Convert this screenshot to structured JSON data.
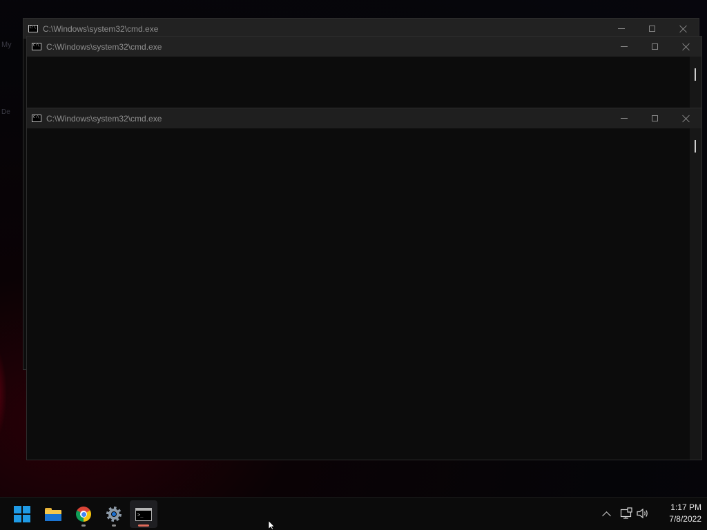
{
  "desktop": {
    "ghost_icon_labels": [
      "My",
      "De"
    ]
  },
  "windows": [
    {
      "title": "C:\\Windows\\system32\\cmd.exe",
      "state": "background",
      "controls": {
        "minimize": "minimize-icon",
        "maximize": "maximize-icon",
        "close": "close-icon"
      }
    },
    {
      "title": "C:\\Windows\\system32\\cmd.exe",
      "state": "background",
      "controls": {
        "minimize": "minimize-icon",
        "maximize": "maximize-icon",
        "close": "close-icon"
      }
    },
    {
      "title": "C:\\Windows\\system32\\cmd.exe",
      "state": "front",
      "controls": {
        "minimize": "minimize-icon",
        "maximize": "maximize-icon",
        "close": "close-icon"
      }
    }
  ],
  "taskbar": {
    "pinned": [
      {
        "name": "Start",
        "icon": "windows-logo-icon"
      },
      {
        "name": "File Explorer",
        "icon": "folder-icon"
      },
      {
        "name": "Google Chrome",
        "icon": "chrome-icon",
        "running": true
      },
      {
        "name": "Settings",
        "icon": "gear-icon",
        "running": true
      },
      {
        "name": "Command Prompt",
        "icon": "terminal-icon",
        "running": true,
        "active": true
      }
    ],
    "tray": {
      "chevron": "chevron-up-icon",
      "network": "network-icon",
      "volume": "speaker-icon"
    },
    "clock": {
      "time": "1:17 PM",
      "date": "7/8/2022"
    }
  },
  "colors": {
    "console_bg": "#0c0c0c",
    "titlebar": "#1f1f1f",
    "accent_indicator": "#e06b5a",
    "windows_blue": "#1f9be6"
  }
}
